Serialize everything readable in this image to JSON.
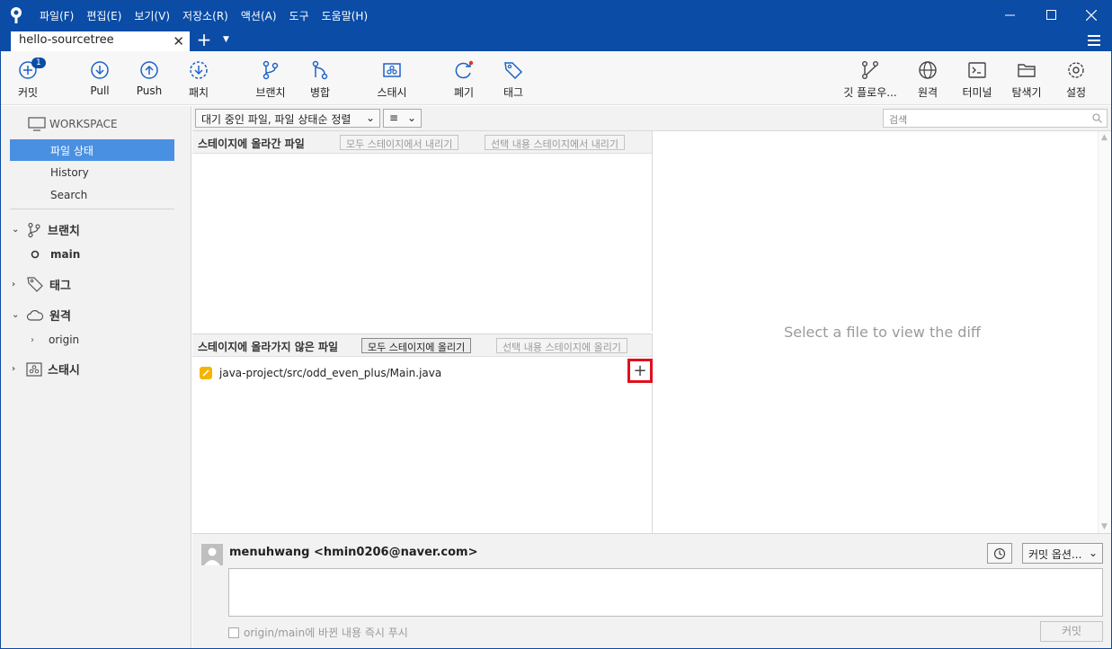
{
  "menu": [
    "파일(F)",
    "편집(E)",
    "보기(V)",
    "저장소(R)",
    "액션(A)",
    "도구",
    "도움말(H)"
  ],
  "tab": {
    "title": "hello-sourcetree"
  },
  "toolbar": {
    "commit": "커밋",
    "commit_badge": "1",
    "pull": "Pull",
    "push": "Push",
    "fetch": "패치",
    "branch": "브랜치",
    "merge": "병합",
    "stash": "스태시",
    "discard": "폐기",
    "tag": "태그",
    "gitflow": "깃 플로우...",
    "remote": "원격",
    "terminal": "터미널",
    "explorer": "탐색기",
    "settings": "설정"
  },
  "sidebar": {
    "workspace": "WORKSPACE",
    "file_status": "파일 상태",
    "history": "History",
    "search": "Search",
    "branches": "브랜치",
    "branch_main": "main",
    "tags": "태그",
    "remotes": "원격",
    "remote_origin": "origin",
    "stashes": "스태시"
  },
  "filter": {
    "sort_dropdown": "대기 중인 파일, 파일 상태순 정렬",
    "view_dropdown": "≡",
    "search_placeholder": "검색"
  },
  "staged": {
    "title": "스테이지에 올라간 파일",
    "unstage_all": "모두 스테이지에서 내리기",
    "unstage_selected": "선택 내용 스테이지에서 내리기"
  },
  "unstaged": {
    "title": "스테이지에 올라가지 않은 파일",
    "stage_all": "모두 스테이지에 올리기",
    "stage_selected": "선택 내용 스테이지에 올리기",
    "files": [
      {
        "path": "java-project/src/odd_even_plus/Main.java",
        "status": "modified"
      }
    ]
  },
  "diff": {
    "message": "Select a file to view the diff"
  },
  "commit": {
    "author": "menuhwang <hmin0206@naver.com>",
    "options": "커밋 옵션...",
    "push_immediately": "origin/main에 바뀐 내용 즉시 푸시",
    "button": "커밋"
  },
  "colors": {
    "titlebar": "#0a4ca6",
    "selection": "#4a90e2",
    "highlight": "#e0101f",
    "modified": "#f5b400"
  }
}
